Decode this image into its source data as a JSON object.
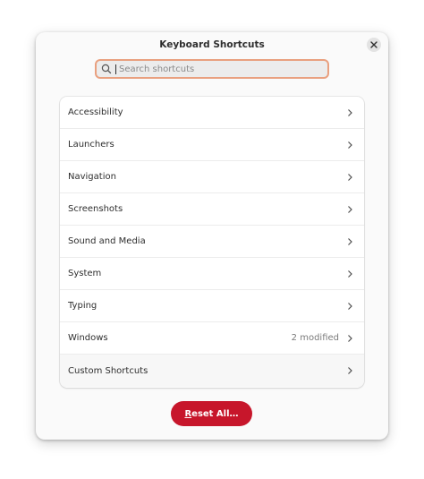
{
  "window": {
    "title": "Keyboard Shortcuts"
  },
  "search": {
    "placeholder": "Search shortcuts",
    "value": ""
  },
  "categories": [
    {
      "label": "Accessibility",
      "detail": ""
    },
    {
      "label": "Launchers",
      "detail": ""
    },
    {
      "label": "Navigation",
      "detail": ""
    },
    {
      "label": "Screenshots",
      "detail": ""
    },
    {
      "label": "Sound and Media",
      "detail": ""
    },
    {
      "label": "System",
      "detail": ""
    },
    {
      "label": "Typing",
      "detail": ""
    },
    {
      "label": "Windows",
      "detail": "2 modified"
    },
    {
      "label": "Custom Shortcuts",
      "detail": ""
    }
  ],
  "reset": {
    "mnemonic": "R",
    "rest": "eset All…"
  },
  "colors": {
    "accent": "#c7162b",
    "focus_ring": "#e9a07f"
  },
  "icons": {
    "close": "close-icon",
    "search": "search-icon",
    "chevron": "chevron-right-icon"
  }
}
